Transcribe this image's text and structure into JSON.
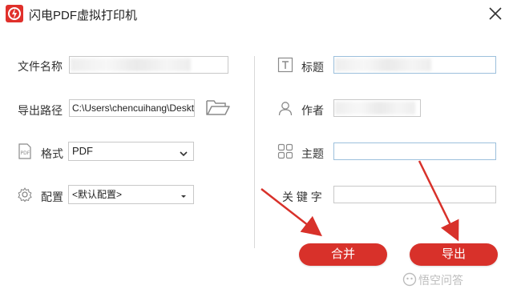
{
  "window": {
    "title": "闪电PDF虚拟打印机"
  },
  "left_form": {
    "filename_label": "文件名称",
    "export_path_label": "导出路径",
    "export_path_value": "C:\\Users\\chencuihang\\Deskto",
    "format_label": "格式",
    "format_value": "PDF",
    "config_label": "配置",
    "config_value": "<默认配置>"
  },
  "right_form": {
    "title_label": "标题",
    "author_label": "作者",
    "subject_label": "主题",
    "keywords_label": "关 键 字"
  },
  "buttons": {
    "merge": "合并",
    "export": "导出"
  },
  "watermark": "悟空问答",
  "colors": {
    "accent_red": "#d8312a",
    "border": "#c8c8c8",
    "focus_border": "#9cc0dc"
  },
  "icons": [
    "app-logo-icon",
    "close-icon",
    "folder-icon",
    "pdf-format-icon",
    "settings-gear-icon",
    "text-t-icon",
    "user-icon",
    "grid-icon",
    "chevron-down-icon",
    "caret-down-icon"
  ]
}
